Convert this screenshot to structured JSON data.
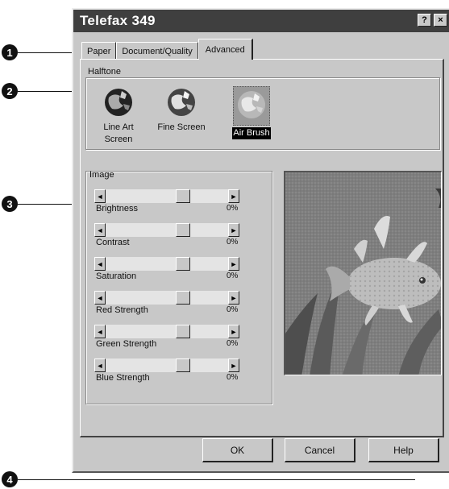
{
  "dialog": {
    "title": "Telefax 349",
    "help_button": "?",
    "close_button": "×"
  },
  "tabs": [
    {
      "label": "Paper"
    },
    {
      "label": "Document/Quality"
    },
    {
      "label": "Advanced"
    }
  ],
  "active_tab": "Advanced",
  "halftone": {
    "label": "Halftone",
    "options": [
      {
        "label": "Line Art Screen",
        "icon": "line-art-globe-icon"
      },
      {
        "label": "Fine Screen",
        "icon": "fine-screen-globe-icon"
      },
      {
        "label": "Air Brush",
        "icon": "air-brush-globe-icon"
      }
    ],
    "selected": "Air Brush"
  },
  "image": {
    "label": "Image",
    "sliders": [
      {
        "label": "Brightness",
        "value": "0%",
        "level": 0.5
      },
      {
        "label": "Contrast",
        "value": "0%",
        "level": 0.5
      },
      {
        "label": "Saturation",
        "value": "0%",
        "level": 0.5
      },
      {
        "label": "Red Strength",
        "value": "0%",
        "level": 0.5
      },
      {
        "label": "Green Strength",
        "value": "0%",
        "level": 0.5
      },
      {
        "label": "Blue Strength",
        "value": "0%",
        "level": 0.5
      }
    ]
  },
  "buttons": {
    "ok": "OK",
    "cancel": "Cancel",
    "help": "Help"
  },
  "callouts": [
    "1",
    "2",
    "3",
    "4"
  ]
}
